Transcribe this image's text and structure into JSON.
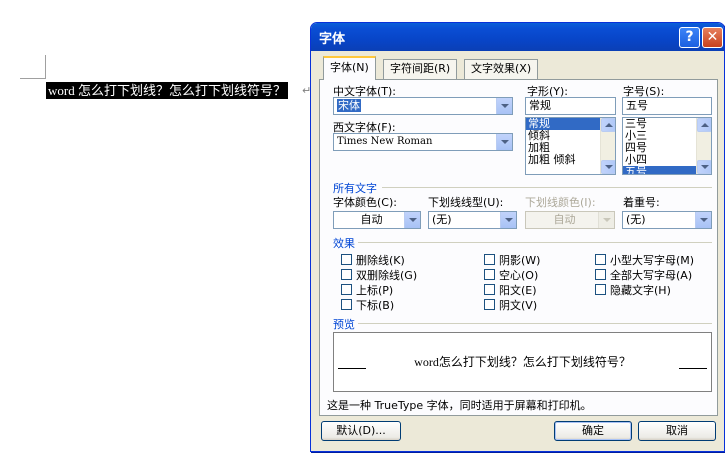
{
  "document": {
    "selected_text": "word 怎么打下划线？怎么打下划线符号？",
    "paragraph_mark": "↵"
  },
  "dialog": {
    "title": "字体",
    "help_button": "?",
    "close_button": "✕",
    "tabs": [
      {
        "label": "字体(N)",
        "active": true
      },
      {
        "label": "字符间距(R)",
        "active": false
      },
      {
        "label": "文字效果(X)",
        "active": false
      }
    ],
    "chinese_font": {
      "label": "中文字体(T):",
      "value": "宋体"
    },
    "western_font": {
      "label": "西文字体(F):",
      "value": "Times New Roman"
    },
    "style": {
      "label": "字形(Y):",
      "value": "常规",
      "options": [
        "常规",
        "倾斜",
        "加粗",
        "加粗 倾斜"
      ],
      "selected": "常规"
    },
    "size": {
      "label": "字号(S):",
      "value": "五号",
      "options": [
        "三号",
        "小三",
        "四号",
        "小四",
        "五号"
      ],
      "selected": "五号"
    },
    "all_text_section": "所有文字",
    "font_color": {
      "label": "字体颜色(C):",
      "value": "自动"
    },
    "underline_type": {
      "label": "下划线线型(U):",
      "value": "(无)"
    },
    "underline_color": {
      "label": "下划线颜色(I):",
      "value": "自动",
      "disabled": true
    },
    "emphasis_mark": {
      "label": "着重号:",
      "value": "(无)"
    },
    "effects_section": "效果",
    "effects": {
      "col1": [
        "删除线(K)",
        "双删除线(G)",
        "上标(P)",
        "下标(B)"
      ],
      "col2": [
        "阴影(W)",
        "空心(O)",
        "阳文(E)",
        "阴文(V)"
      ],
      "col3": [
        "小型大写字母(M)",
        "全部大写字母(A)",
        "隐藏文字(H)"
      ]
    },
    "preview_section": "预览",
    "preview_text": "word怎么打下划线？怎么打下划线符号？",
    "footnote": "这是一种 TrueType 字体，同时适用于屏幕和打印机。",
    "buttons": {
      "default": "默认(D)...",
      "ok": "确定",
      "cancel": "取消"
    }
  },
  "colors": {
    "titlebar": "#0a4ed4",
    "dialog_bg": "#ece9d8",
    "selection": "#316ac5",
    "section_title": "#0046d5"
  }
}
